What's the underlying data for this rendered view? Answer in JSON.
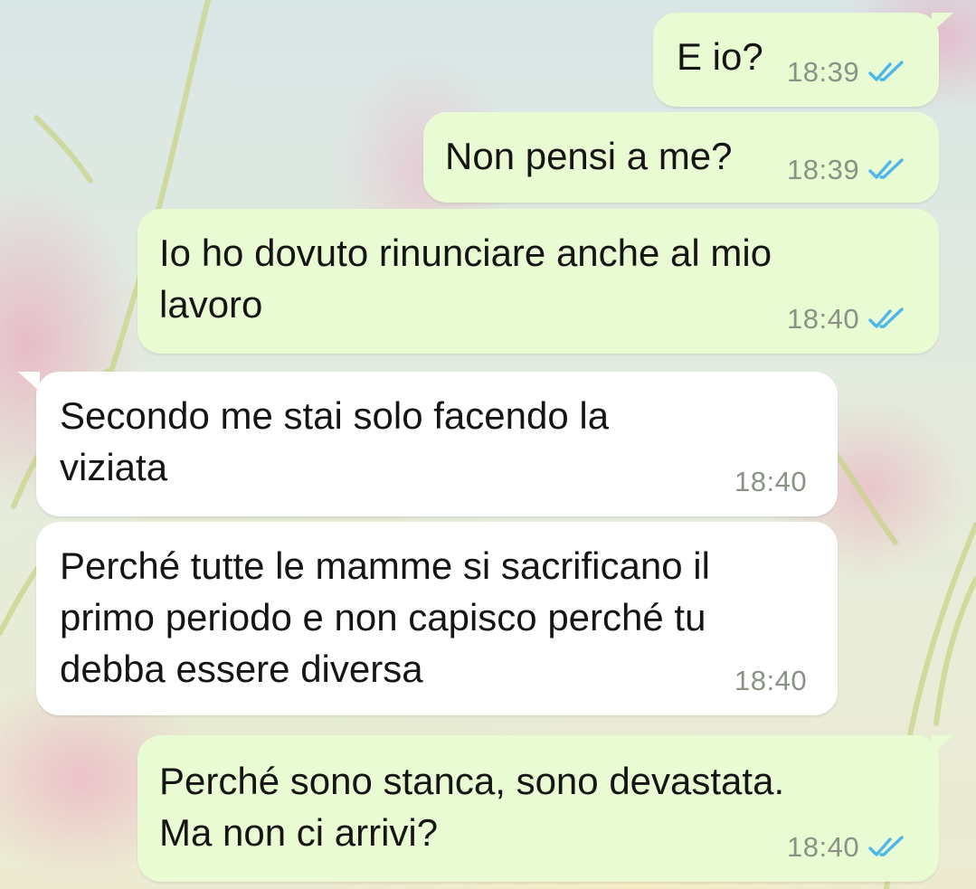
{
  "conversation": {
    "messages": [
      {
        "direction": "out",
        "lines": [
          "E io?"
        ],
        "time": "18:39",
        "status": "read"
      },
      {
        "direction": "out",
        "lines": [
          "Non pensi a me?"
        ],
        "time": "18:39",
        "status": "read"
      },
      {
        "direction": "out",
        "lines": [
          "Io ho dovuto rinunciare anche al mio",
          "lavoro"
        ],
        "time": "18:40",
        "status": "read"
      },
      {
        "direction": "in",
        "lines": [
          "Secondo me stai solo facendo la",
          "viziata"
        ],
        "time": "18:40"
      },
      {
        "direction": "in",
        "lines": [
          "Perché tutte le mamme si sacrificano il",
          "primo periodo e non capisco perché tu",
          "debba essere diversa"
        ],
        "time": "18:40"
      },
      {
        "direction": "out",
        "lines": [
          "Perché sono stanca, sono devastata.",
          "Ma non ci arrivi?"
        ],
        "time": "18:40",
        "status": "read"
      }
    ]
  },
  "icons": {
    "read_status": "double-check-icon"
  },
  "colors": {
    "outgoing_bubble": "#e8fbd3",
    "incoming_bubble": "#ffffff",
    "read_ticks": "#4fb6ec",
    "timestamp": "#8a9286"
  }
}
